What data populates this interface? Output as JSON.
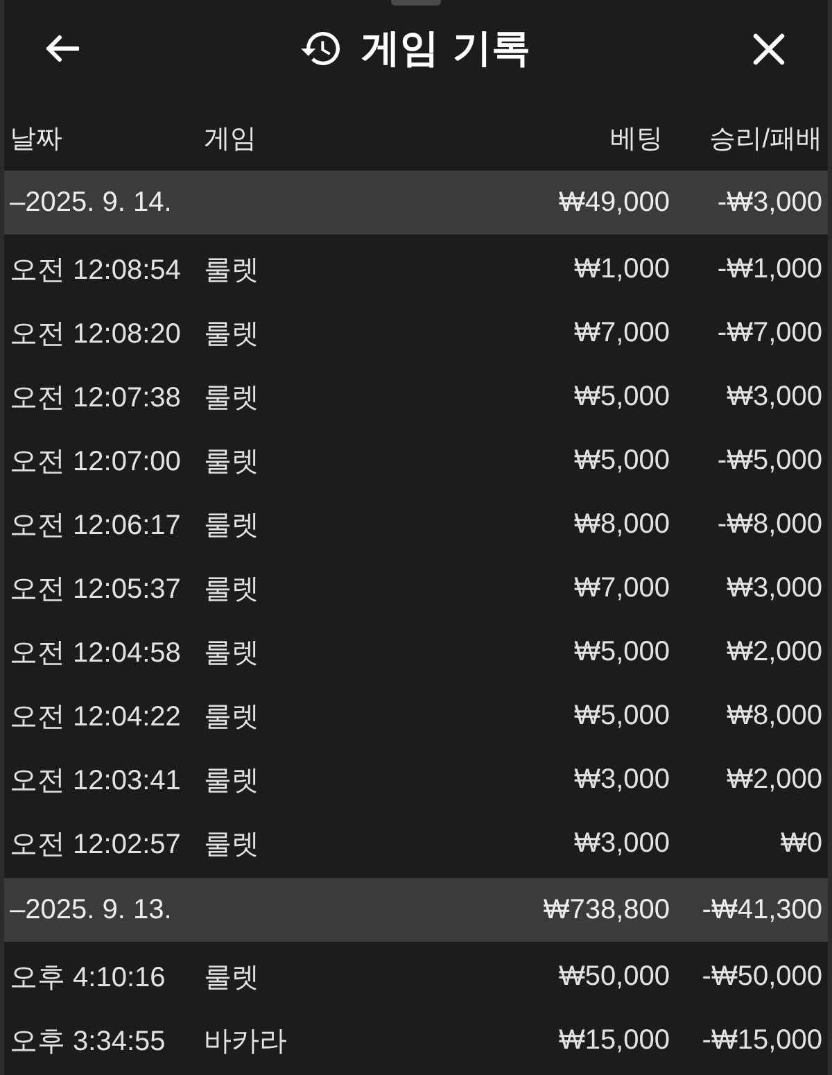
{
  "header": {
    "title": "게임 기록"
  },
  "columns": [
    "날짜",
    "게임",
    "베팅",
    "승리/패배"
  ],
  "groups": [
    {
      "date": "–2025. 9. 14.",
      "bet_total": "₩49,000",
      "result_total": "-₩3,000",
      "rows": [
        {
          "time": "오전 12:08:54",
          "game": "룰렛",
          "bet": "₩1,000",
          "result": "-₩1,000"
        },
        {
          "time": "오전 12:08:20",
          "game": "룰렛",
          "bet": "₩7,000",
          "result": "-₩7,000"
        },
        {
          "time": "오전 12:07:38",
          "game": "룰렛",
          "bet": "₩5,000",
          "result": "₩3,000"
        },
        {
          "time": "오전 12:07:00",
          "game": "룰렛",
          "bet": "₩5,000",
          "result": "-₩5,000"
        },
        {
          "time": "오전 12:06:17",
          "game": "룰렛",
          "bet": "₩8,000",
          "result": "-₩8,000"
        },
        {
          "time": "오전 12:05:37",
          "game": "룰렛",
          "bet": "₩7,000",
          "result": "₩3,000"
        },
        {
          "time": "오전 12:04:58",
          "game": "룰렛",
          "bet": "₩5,000",
          "result": "₩2,000"
        },
        {
          "time": "오전 12:04:22",
          "game": "룰렛",
          "bet": "₩5,000",
          "result": "₩8,000"
        },
        {
          "time": "오전 12:03:41",
          "game": "룰렛",
          "bet": "₩3,000",
          "result": "₩2,000"
        },
        {
          "time": "오전 12:02:57",
          "game": "룰렛",
          "bet": "₩3,000",
          "result": "₩0"
        }
      ]
    },
    {
      "date": "–2025. 9. 13.",
      "bet_total": "₩738,800",
      "result_total": "-₩41,300",
      "rows": [
        {
          "time": "오후 4:10:16",
          "game": "룰렛",
          "bet": "₩50,000",
          "result": "-₩50,000"
        },
        {
          "time": "오후 3:34:55",
          "game": "바카라",
          "bet": "₩15,000",
          "result": "-₩15,000"
        }
      ]
    }
  ]
}
